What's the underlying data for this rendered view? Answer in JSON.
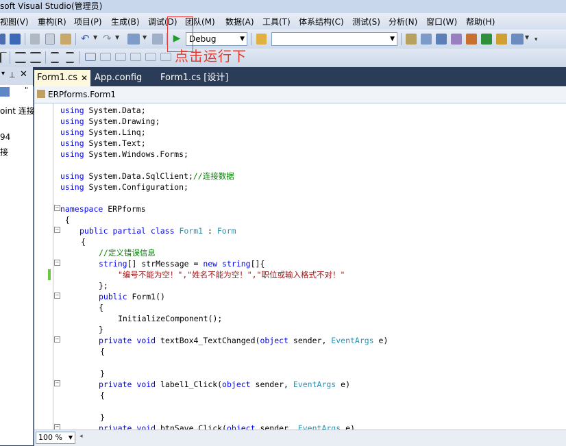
{
  "window": {
    "title": "soft Visual Studio(管理员)"
  },
  "menu": [
    "视图(V)",
    "重构(R)",
    "项目(P)",
    "生成(B)",
    "调试(D)",
    "团队(M)",
    "数据(A)",
    "工具(T)",
    "体系结构(C)",
    "测试(S)",
    "分析(N)",
    "窗口(W)",
    "帮助(H)"
  ],
  "toolbar": {
    "config_value": "Debug",
    "platform_value": ""
  },
  "annotation": "点击运行下",
  "left_panel": {
    "line1": "oint 连接",
    "line2": "94",
    "line3": "接"
  },
  "tabs": [
    "Form1.cs",
    "App.config",
    "Form1.cs [设计]"
  ],
  "navbar": {
    "class_path": "ERPforms.Form1"
  },
  "code": {
    "lines": [
      [
        "using",
        " System.Data;"
      ],
      [
        "using",
        " System.Drawing;"
      ],
      [
        "using",
        " System.Linq;"
      ],
      [
        "using",
        " System.Text;"
      ],
      [
        "using",
        " System.Windows.Forms;"
      ],
      [
        "using",
        " System.Data.SqlClient;"
      ],
      [
        "using",
        " System.Configuration;"
      ]
    ],
    "comment_connect": "//连接数据",
    "namespace_kw": "namespace",
    "namespace_name": " ERPforms",
    "open_brace": " {",
    "class_decl": {
      "kw1": "public",
      "kw2": "partial",
      "kw3": "class",
      "name": "Form1",
      "colon": " : ",
      "base": "Form"
    },
    "class_open": "{",
    "comment_error": "//定义错误信息",
    "array_decl": {
      "type": "string",
      "rest": "[] strMessage = ",
      "kw_new": "new",
      "type2": "string",
      "brace": "[]{"
    },
    "string_values": "\"编号不能为空！\",\"姓名不能为空！\",\"职位或输入格式不对！\"",
    "array_close": "};",
    "ctor": {
      "kw": "public",
      "name": " Form1()"
    },
    "ctor_open": "{",
    "init_call": "InitializeComponent();",
    "ctor_close": "}",
    "method1": {
      "kw1": "private",
      "kw2": "void",
      "name": " textBox4_TextChanged(",
      "kw3": "object",
      "p1": " sender, ",
      "type": "EventArgs",
      "p2": " e)"
    },
    "m1_open": "{",
    "m1_close": "}",
    "method2": {
      "kw1": "private",
      "kw2": "void",
      "name": " label1_Click(",
      "kw3": "object",
      "p1": " sender, ",
      "type": "EventArgs",
      "p2": " e)"
    },
    "m2_open": "{",
    "m2_close": "}",
    "method3": {
      "kw1": "private",
      "kw2": "void",
      "name": " btnSave_Click(",
      "kw3": "object",
      "p1": " sender, ",
      "type": "EventArgs",
      "p2": " e)"
    }
  },
  "status": {
    "zoom": "100 %"
  },
  "colors": {
    "keyword": "#0000ff",
    "type": "#2b91af",
    "comment": "#008000",
    "string": "#a31515",
    "annotation": "#e53a2b",
    "chrome_dark": "#2b3c59"
  }
}
